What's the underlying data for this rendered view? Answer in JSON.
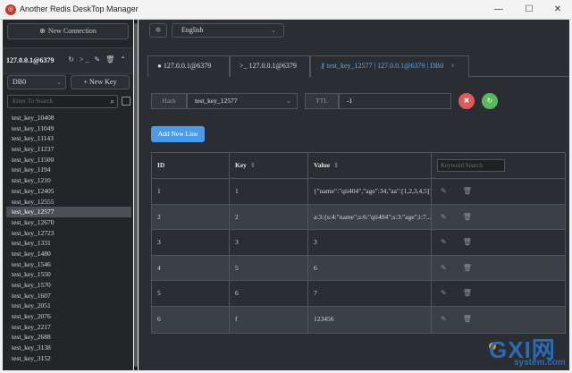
{
  "window": {
    "title": "Another Redis DeskTop Manager",
    "minimize": "—",
    "maximize": "☐",
    "close": "✕"
  },
  "sidebar": {
    "new_connection_label": "New Connection",
    "connection_name": "127.0.0.1@6379",
    "connection_tools": "↻ >_ ✎ 🗑 ⌃",
    "db_select": "DB0",
    "new_key_label": "+ New Key",
    "search_placeholder": "Enter To Search",
    "keys": [
      "test_key_10408",
      "test_key_11049",
      "test_key_11143",
      "test_key_11237",
      "test_key_11500",
      "test_key_1194",
      "test_key_1210",
      "test_key_12405",
      "test_key_12555",
      "test_key_12577",
      "test_key_12670",
      "test_key_12723",
      "test_key_1331",
      "test_key_1480",
      "test_key_1546",
      "test_key_1550",
      "test_key_1570",
      "test_key_1607",
      "test_key_2051",
      "test_key_2076",
      "test_key_2217",
      "test_key_2688",
      "test_key_3138",
      "test_key_3152"
    ],
    "active_key": "test_key_12577"
  },
  "header": {
    "settings_icon": "gear-icon",
    "language": "English"
  },
  "tabs": [
    {
      "label": "127.0.0.1@6379",
      "icon": "info-icon",
      "active": false
    },
    {
      "label": ">_ 127.0.0.1@6379",
      "icon": "terminal-icon",
      "active": false
    },
    {
      "label": "test_key_12577 | 127.0.0.1@6379 | DB0",
      "icon": "key-icon",
      "active": true,
      "close": "×"
    }
  ],
  "key_detail": {
    "type_label": "Hash",
    "key_name": "test_key_12577",
    "ttl_label": "TTL",
    "ttl_value": "-1",
    "add_new_line_label": "Add New Line"
  },
  "table": {
    "columns": [
      "ID",
      "Key",
      "Value"
    ],
    "keyword_search_placeholder": "Keyword Search",
    "rows": [
      {
        "id": "1",
        "key": "1",
        "value": "{\"name\":\"qii404\",\"age\":34,\"aa\":[1,2,3,4,5]}"
      },
      {
        "id": "2",
        "key": "2",
        "value": "a:3:{s:4:\"name\";s:6:\"qii404\";s:3:\"age\";i:7..."
      },
      {
        "id": "3",
        "key": "3",
        "value": "3"
      },
      {
        "id": "4",
        "key": "5",
        "value": "6"
      },
      {
        "id": "5",
        "key": "6",
        "value": "7"
      },
      {
        "id": "6",
        "key": "f",
        "value": "123456"
      }
    ]
  },
  "watermark": {
    "big": "GXI网",
    "small": "system.com"
  },
  "colors": {
    "accent": "#4b9be8",
    "delete": "#e05a5a",
    "refresh": "#5cb85c",
    "active_tab": "#6aa8e8"
  }
}
